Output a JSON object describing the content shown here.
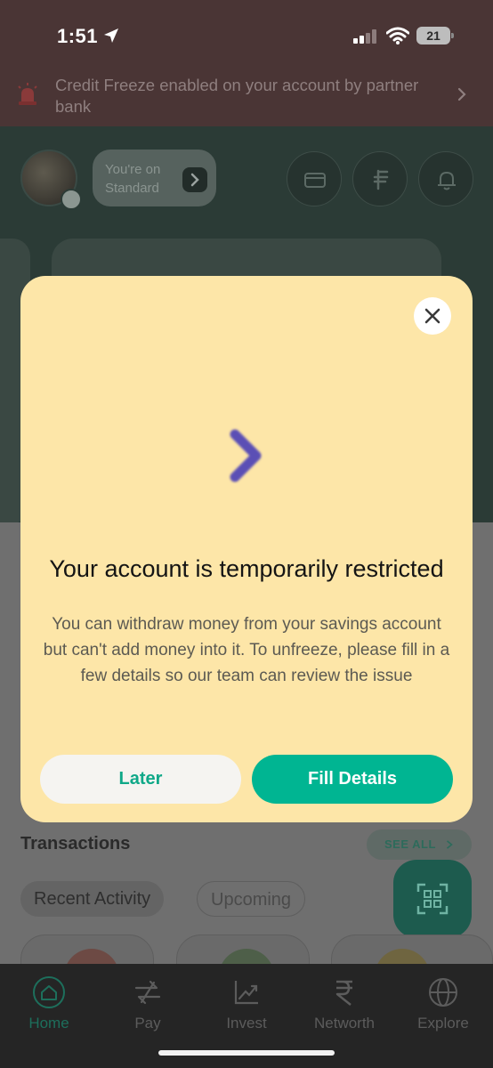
{
  "status_bar": {
    "time": "1:51",
    "battery": "21"
  },
  "banner": {
    "text": "Credit Freeze enabled on your account by partner bank",
    "icon": "siren-icon"
  },
  "header": {
    "plan_chip": "You're on Standard"
  },
  "modal": {
    "title": "Your account is temporarily restricted",
    "body": "You can withdraw money from your savings account but can't add money into it. To unfreeze, please fill in a few details so our team can review the issue",
    "later_label": "Later",
    "fill_label": "Fill Details",
    "accent": "#00b592",
    "background": "#fde6a8",
    "chevron_color": "#5b4fb5"
  },
  "transactions": {
    "title": "Transactions",
    "see_all": "SEE ALL",
    "tabs": [
      "Recent Activity",
      "Upcoming"
    ]
  },
  "nav": {
    "items": [
      {
        "label": "Home",
        "icon": "home-icon",
        "active": true
      },
      {
        "label": "Pay",
        "icon": "pay-icon",
        "active": false
      },
      {
        "label": "Invest",
        "icon": "invest-icon",
        "active": false
      },
      {
        "label": "Networth",
        "icon": "rupee-icon",
        "active": false
      },
      {
        "label": "Explore",
        "icon": "globe-icon",
        "active": false
      }
    ]
  }
}
